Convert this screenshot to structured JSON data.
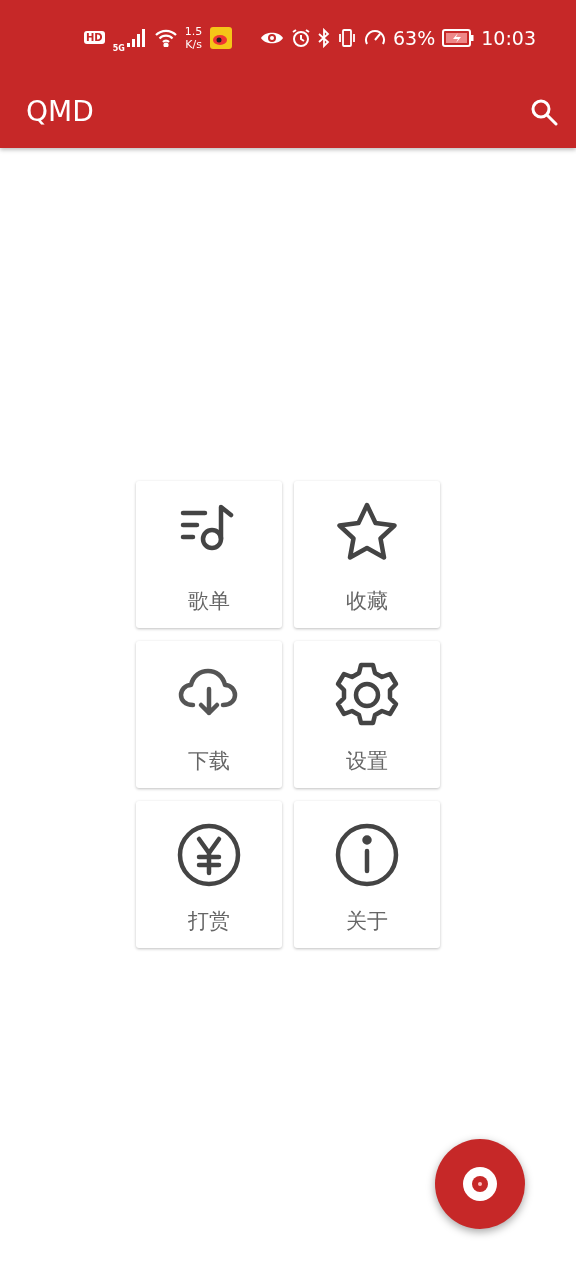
{
  "status_bar": {
    "hd": "HD",
    "network": "5G",
    "speed_value": "1.5",
    "speed_unit": "K/s",
    "battery": "63%",
    "time": "10:03"
  },
  "app_bar": {
    "title": "QMD"
  },
  "tiles": [
    {
      "kind": "playlist",
      "label": "歌单"
    },
    {
      "kind": "star",
      "label": "收藏"
    },
    {
      "kind": "download",
      "label": "下载"
    },
    {
      "kind": "settings",
      "label": "设置"
    },
    {
      "kind": "reward",
      "label": "打赏"
    },
    {
      "kind": "about",
      "label": "关于"
    }
  ]
}
